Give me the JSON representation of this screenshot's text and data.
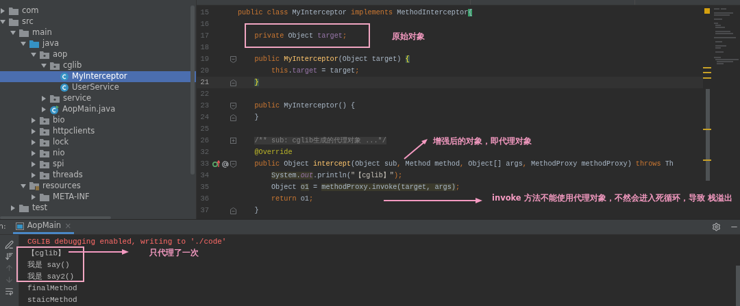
{
  "project_tree": [
    {
      "label": "com",
      "kind": "folder",
      "expanded": false,
      "selected": false
    },
    {
      "label": "src",
      "kind": "folder",
      "expanded": true,
      "selected": false,
      "children": [
        {
          "label": "main",
          "kind": "folder",
          "expanded": true,
          "selected": false,
          "children": [
            {
              "label": "java",
              "kind": "source",
              "expanded": true,
              "selected": false,
              "children": [
                {
                  "label": "aop",
                  "kind": "package",
                  "expanded": true,
                  "selected": false,
                  "children": [
                    {
                      "label": "cglib",
                      "kind": "package",
                      "expanded": true,
                      "selected": false,
                      "children": [
                        {
                          "label": "MyInterceptor",
                          "kind": "class",
                          "selected": true
                        },
                        {
                          "label": "UserService",
                          "kind": "class",
                          "selected": false
                        }
                      ]
                    },
                    {
                      "label": "service",
                      "kind": "package",
                      "expanded": false,
                      "selected": false
                    },
                    {
                      "label": "AopMain.java",
                      "kind": "main_class",
                      "expanded": false,
                      "selected": false
                    }
                  ]
                },
                {
                  "label": "bio",
                  "kind": "package",
                  "expanded": false,
                  "selected": false
                },
                {
                  "label": "httpclients",
                  "kind": "package",
                  "expanded": false,
                  "selected": false
                },
                {
                  "label": "lock",
                  "kind": "package",
                  "expanded": false,
                  "selected": false
                },
                {
                  "label": "nio",
                  "kind": "package",
                  "expanded": false,
                  "selected": false
                },
                {
                  "label": "spi",
                  "kind": "package",
                  "expanded": false,
                  "selected": false
                },
                {
                  "label": "threads",
                  "kind": "package",
                  "expanded": false,
                  "selected": false
                }
              ]
            },
            {
              "label": "resources",
              "kind": "resources",
              "expanded": true,
              "selected": false,
              "children": [
                {
                  "label": "META-INF",
                  "kind": "folder",
                  "expanded": false,
                  "selected": false
                }
              ]
            }
          ]
        },
        {
          "label": "test",
          "kind": "folder",
          "expanded": false,
          "selected": false
        }
      ]
    }
  ],
  "editor": {
    "lines": [
      {
        "number": "15",
        "current": false,
        "tokens": [
          {
            "kind": "kw",
            "text": "public class "
          },
          {
            "kind": "plain",
            "text": "MyInterceptor "
          },
          {
            "kind": "kw",
            "text": "implements "
          },
          {
            "kind": "plain",
            "text": "MethodInterceptor"
          },
          {
            "kind": "match",
            "text": "{"
          }
        ]
      },
      {
        "number": "16",
        "current": false
      },
      {
        "number": "17",
        "current": false,
        "tokens": [
          {
            "kind": "kw",
            "text": "    private "
          },
          {
            "kind": "plain",
            "text": "Object "
          },
          {
            "kind": "field",
            "text": "target"
          },
          {
            "kind": "kw",
            "text": ";"
          }
        ]
      },
      {
        "number": "18",
        "current": false
      },
      {
        "number": "19",
        "current": false,
        "fold": {
          "kind": "open"
        },
        "tokens": [
          {
            "kind": "kw",
            "text": "    public "
          },
          {
            "kind": "fn",
            "text": "MyInterceptor"
          },
          {
            "kind": "plain",
            "text": "(Object target) "
          },
          {
            "kind": "brace",
            "text": "{"
          }
        ]
      },
      {
        "number": "20",
        "current": false,
        "tokens": [
          {
            "kind": "kw",
            "text": "        this"
          },
          {
            "kind": "plain",
            "text": "."
          },
          {
            "kind": "field",
            "text": "target"
          },
          {
            "kind": "plain",
            "text": " = target"
          },
          {
            "kind": "kw",
            "text": ";"
          }
        ]
      },
      {
        "number": "21",
        "current": true,
        "fold": {
          "kind": "close"
        },
        "tokens": [
          {
            "kind": "brace",
            "text": "    }"
          }
        ]
      },
      {
        "number": "22",
        "current": false
      },
      {
        "number": "23",
        "current": false,
        "fold": {
          "kind": "open"
        },
        "tokens": [
          {
            "kind": "kw",
            "text": "    public "
          },
          {
            "kind": "plain",
            "text": "MyInterceptor() {"
          }
        ]
      },
      {
        "number": "24",
        "current": false,
        "fold": {
          "kind": "close"
        },
        "tokens": [
          {
            "kind": "plain",
            "text": "    }"
          }
        ]
      },
      {
        "number": "25",
        "current": false
      },
      {
        "number": "26",
        "current": false,
        "fold": {
          "kind": "collapsed"
        },
        "tokens": [
          {
            "kind": "folded",
            "text": "    /** sub: cglib生成的代理对象 ...*/"
          }
        ]
      },
      {
        "number": "32",
        "current": false,
        "tokens": [
          {
            "kind": "annot",
            "text": "    @Override"
          }
        ]
      },
      {
        "number": "33",
        "current": false,
        "fold": {
          "kind": "open"
        },
        "gutter": [
          {
            "kind": "override"
          },
          {
            "kind": "annotation"
          }
        ],
        "tokens": [
          {
            "kind": "kw",
            "text": "    public "
          },
          {
            "kind": "plain",
            "text": "Object "
          },
          {
            "kind": "fn",
            "text": "intercept"
          },
          {
            "kind": "plain",
            "text": "(Object sub"
          },
          {
            "kind": "kw",
            "text": ", "
          },
          {
            "kind": "plain",
            "text": "Method method"
          },
          {
            "kind": "kw",
            "text": ", "
          },
          {
            "kind": "plain",
            "text": "Object[] args"
          },
          {
            "kind": "kw",
            "text": ", "
          },
          {
            "kind": "plain",
            "text": "MethodProxy methodProxy) "
          },
          {
            "kind": "kw",
            "text": "throws "
          },
          {
            "kind": "plain",
            "text": "Th"
          }
        ]
      },
      {
        "number": "34",
        "current": false,
        "tokens": [
          {
            "kind": "usage",
            "text": "        System."
          },
          {
            "kind": "static",
            "text": "out"
          },
          {
            "kind": "plain",
            "text": ".println("
          },
          {
            "kind": "str",
            "text": "\"【cglib】\""
          },
          {
            "kind": "kw",
            "text": ");"
          }
        ]
      },
      {
        "number": "35",
        "current": false,
        "tokens": [
          {
            "kind": "plain",
            "text": "        Object "
          },
          {
            "kind": "usage",
            "text": "o1"
          },
          {
            "kind": "plain",
            "text": " = "
          },
          {
            "kind": "usage",
            "text": "methodProxy.invoke(target, args)"
          },
          {
            "kind": "kw",
            "text": ";"
          }
        ]
      },
      {
        "number": "36",
        "current": false,
        "tokens": [
          {
            "kind": "kw",
            "text": "        return "
          },
          {
            "kind": "plain",
            "text": "o1"
          },
          {
            "kind": "kw",
            "text": ";"
          }
        ]
      },
      {
        "number": "37",
        "current": false,
        "fold": {
          "kind": "close"
        },
        "tokens": [
          {
            "kind": "plain",
            "text": "    }"
          }
        ]
      }
    ]
  },
  "run_panel": {
    "label": "n:",
    "tab": {
      "title": "AopMain",
      "close": "×"
    },
    "console": [
      {
        "kind": "error",
        "text": "CGLIB debugging enabled, writing to './code'"
      },
      {
        "kind": "output",
        "text": "【cglib】"
      },
      {
        "kind": "output",
        "text": "我是 say()"
      },
      {
        "kind": "output",
        "text": "我是 say2()"
      },
      {
        "kind": "output",
        "text": "finalMethod"
      },
      {
        "kind": "output",
        "text": "staicMethod"
      }
    ]
  },
  "annotations": [
    {
      "text": "原始对象"
    },
    {
      "text": "增强后的对象，即代理对象"
    },
    {
      "text": "invoke 方法不能使用代理对象，不然会进入死循环，导致 栈溢出"
    },
    {
      "text": "只代理了一次"
    }
  ]
}
